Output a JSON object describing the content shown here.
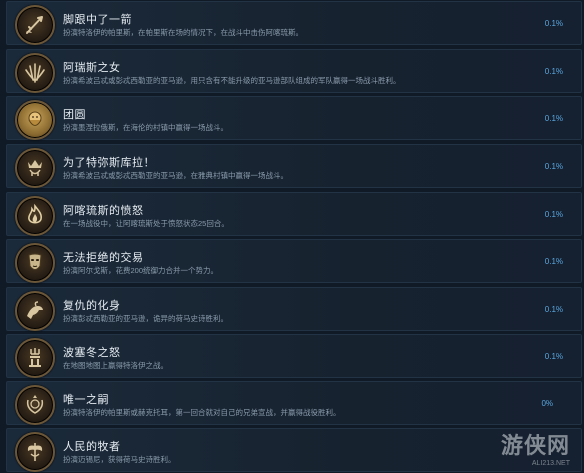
{
  "achievements": [
    {
      "title": "脚跟中了一箭",
      "desc": "扮演特洛伊的帕里斯，在帕里斯在场的情况下，在战斗中击伤阿喀琉斯。",
      "percent": "0.1%",
      "icon": "arrow-heel-icon"
    },
    {
      "title": "阿瑞斯之女",
      "desc": "扮演希波吕忒或彭忒西勒亚的亚马逊，用只含有不能升级的亚马逊部队组成的军队赢得一场战斗胜利。",
      "percent": "0.1%",
      "icon": "laurel-spears-icon"
    },
    {
      "title": "团圆",
      "desc": "扮演墨涅拉俄斯，在海伦的村镇中赢得一场战斗。",
      "percent": "0.1%",
      "icon": "bearded-face-icon"
    },
    {
      "title": "为了特弥斯库拉！",
      "desc": "扮演希波吕忒或彭忒西勒亚的亚马逊，在雅典村镇中赢得一场战斗。",
      "percent": "0.1%",
      "icon": "crowned-figure-icon"
    },
    {
      "title": "阿喀琉斯的愤怒",
      "desc": "在一场战役中，让阿喀琉斯处于愤怒状态25回合。",
      "percent": "0.1%",
      "icon": "flame-icon"
    },
    {
      "title": "无法拒绝的交易",
      "desc": "扮演阿尔戈斯，花费200统御力合并一个势力。",
      "percent": "0.1%",
      "icon": "mask-icon"
    },
    {
      "title": "复仇的化身",
      "desc": "扮演彭忒西勒亚的亚马逊，诡异的荷马史诗胜利。",
      "percent": "0.1%",
      "icon": "griffin-icon"
    },
    {
      "title": "波塞冬之怒",
      "desc": "在地图地图上赢得特洛伊之战。",
      "percent": "0.1%",
      "icon": "trident-temple-icon"
    },
    {
      "title": "唯一之嗣",
      "desc": "扮演特洛伊的帕里斯或赫克托耳，第一回合就对自己的兄弟宣战，并赢得战役胜利。",
      "percent": "0%",
      "icon": "olive-wreath-icon"
    },
    {
      "title": "人民的牧者",
      "desc": "扮演迈锡尼，获得荷马史诗胜利。",
      "percent": "",
      "icon": "double-axe-icon"
    }
  ],
  "watermark": {
    "main": "游侠网",
    "sub": "ALI213.NET"
  }
}
